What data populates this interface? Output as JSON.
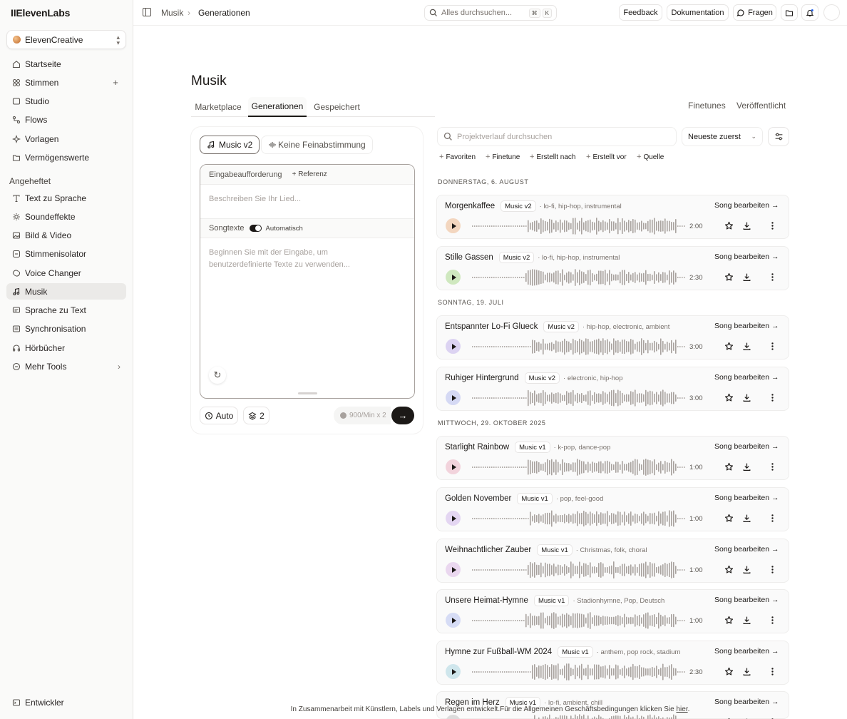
{
  "sidebar": {
    "logo": "IIElevenLabs",
    "workspace": "ElevenCreative",
    "nav": [
      {
        "label": "Startseite",
        "icon": "home-icon"
      },
      {
        "label": "Stimmen",
        "icon": "voices-icon"
      },
      {
        "label": "Studio",
        "icon": "studio-icon"
      },
      {
        "label": "Flows",
        "icon": "flows-icon"
      },
      {
        "label": "Vorlagen",
        "icon": "templates-icon"
      },
      {
        "label": "Vermögenswerte",
        "icon": "folder-icon"
      }
    ],
    "pinned_label": "Angeheftet",
    "pinned": [
      {
        "label": "Text zu Sprache",
        "icon": "tts-icon"
      },
      {
        "label": "Soundeffekte",
        "icon": "sound-effects-icon"
      },
      {
        "label": "Bild & Video",
        "icon": "image-video-icon"
      },
      {
        "label": "Stimmenisolator",
        "icon": "isolator-icon"
      },
      {
        "label": "Voice Changer",
        "icon": "voice-changer-icon"
      },
      {
        "label": "Musik",
        "icon": "music-icon"
      },
      {
        "label": "Sprache zu Text",
        "icon": "stt-icon"
      },
      {
        "label": "Synchronisation",
        "icon": "dubbing-icon"
      },
      {
        "label": "Hörbücher",
        "icon": "audiobook-icon"
      },
      {
        "label": "Mehr Tools",
        "icon": "more-tools-icon"
      }
    ],
    "developer": "Entwickler"
  },
  "topbar": {
    "breadcrumb": [
      "Musik",
      "Generationen"
    ],
    "search_placeholder": "Alles durchsuchen...",
    "kbd": [
      "⌘",
      "K"
    ],
    "feedback": "Feedback",
    "docs": "Dokumentation",
    "ask": "Fragen"
  },
  "page": {
    "title": "Musik",
    "tabs": [
      "Marketplace",
      "Generationen",
      "Gespeichert"
    ],
    "right_tabs": [
      "Finetunes",
      "Veröffentlicht"
    ]
  },
  "composer": {
    "model": "Music v2",
    "finetune": "Keine Feinabstimmung",
    "prompt_label": "Eingabeaufforderung",
    "reference": "Referenz",
    "prompt_placeholder": "Beschreiben Sie Ihr Lied...",
    "lyrics_label": "Songtexte",
    "lyrics_mode": "Automatisch",
    "lyrics_placeholder": "Beginnen Sie mit der Eingabe, um benutzerdefinierte Texte zu verwenden...",
    "duration": "Auto",
    "variants": "2",
    "credits": "900/Min x 2"
  },
  "list": {
    "search_placeholder": "Projektverlauf durchsuchen",
    "sort": "Neueste zuerst",
    "filters": [
      "Favoriten",
      "Finetune",
      "Erstellt nach",
      "Erstellt vor",
      "Quelle"
    ],
    "edit_label": "Song bearbeiten →",
    "groups": [
      {
        "date": "DONNERSTAG, 6. AUGUST",
        "items": [
          {
            "title": "Morgenkaffee",
            "model": "Music v2",
            "tags": "· lo-fi, hip-hop, instrumental",
            "duration": "2:00",
            "color": "#f3d6bf"
          },
          {
            "title": "Stille Gassen",
            "model": "Music v2",
            "tags": "· lo-fi, hip-hop, instrumental",
            "duration": "2:30",
            "color": "#cfe8bf"
          }
        ]
      },
      {
        "date": "SONNTAG, 19. JULI",
        "items": [
          {
            "title": "Entspannter Lo-Fi Glueck",
            "model": "Music v2",
            "tags": "· hip-hop, electronic, ambient",
            "duration": "3:00",
            "color": "#dcd3f2"
          },
          {
            "title": "Ruhiger Hintergrund",
            "model": "Music v2",
            "tags": "· electronic, hip-hop",
            "duration": "3:00",
            "color": "#d5d9f4"
          }
        ]
      },
      {
        "date": "MITTWOCH, 29. OKTOBER 2025",
        "items": [
          {
            "title": "Starlight Rainbow",
            "model": "Music v1",
            "tags": "· k-pop, dance-pop",
            "duration": "1:00",
            "color": "#f2d3dc"
          },
          {
            "title": "Golden November",
            "model": "Music v1",
            "tags": "· pop, feel-good",
            "duration": "1:00",
            "color": "#e4d6f2"
          },
          {
            "title": "Weihnachtlicher Zauber",
            "model": "Music v1",
            "tags": "· Christmas, folk, choral",
            "duration": "1:00",
            "color": "#ead7ef"
          },
          {
            "title": "Unsere Heimat-Hymne",
            "model": "Music v1",
            "tags": "· Stadionhymne, Pop, Deutsch",
            "duration": "1:00",
            "color": "#d6dcf5"
          },
          {
            "title": "Hymne zur Fußball-WM 2024",
            "model": "Music v1",
            "tags": "· anthem, pop rock, stadium",
            "duration": "2:30",
            "color": "#cfe6ec"
          },
          {
            "title": "Regen im Herz",
            "model": "Music v1",
            "tags": "· lo-fi, ambient, chill",
            "duration": "",
            "color": "#dcdcdc"
          }
        ]
      }
    ]
  },
  "footer": {
    "text": "In Zusammenarbeit mit Künstlern, Labels und Verlagen entwickelt.Für die Allgemeinen Geschäftsbedingungen klicken Sie ",
    "link": "hier",
    "end": "."
  }
}
